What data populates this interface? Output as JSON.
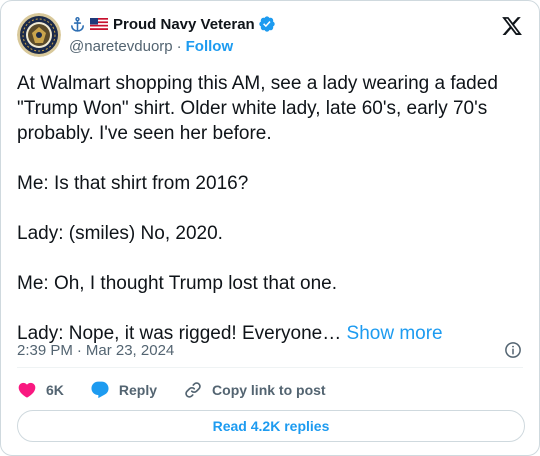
{
  "header": {
    "display_name": "Proud Navy Veteran",
    "handle": "@naretevduorp",
    "separator": "·",
    "follow_label": "Follow"
  },
  "tweet": {
    "lines": [
      "At Walmart shopping this AM, see a lady wearing a faded",
      "\"Trump Won\" shirt. Older white lady, late 60's, early 70's",
      "probably. I've seen her before.",
      "",
      "Me: Is that shirt from 2016?",
      "",
      "Lady: (smiles) No, 2020.",
      "",
      "Me: Oh, I thought Trump lost that one.",
      "",
      "Lady: Nope, it was rigged! Everyone…"
    ],
    "show_more": "Show more",
    "time": "2:39 PM",
    "date": "Mar 23, 2024"
  },
  "actions": {
    "like_count": "6K",
    "reply_label": "Reply",
    "copy_label": "Copy link to post"
  },
  "replies_button": "Read 4.2K replies",
  "colors": {
    "accent": "#1d9bf0",
    "like": "#f91880",
    "muted": "#536471",
    "border": "#cfd9de"
  },
  "icons": [
    "anchor-icon",
    "us-flag-icon",
    "verified-badge-icon",
    "x-logo-icon",
    "info-icon",
    "heart-icon",
    "reply-bubble-icon",
    "link-icon"
  ]
}
